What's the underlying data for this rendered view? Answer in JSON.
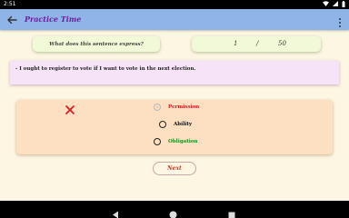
{
  "status_bar": {
    "time": "2:51"
  },
  "app_bar": {
    "title": "Practice Time"
  },
  "question": {
    "prompt": "What does this sentence express?"
  },
  "counter": {
    "current": "1",
    "separator": "/",
    "total": "50"
  },
  "sentence": {
    "text": "- I ought to register to vote if I want to vote in the next election."
  },
  "options": [
    {
      "label": "Permission",
      "color": "#e01b24",
      "state": "selected-wrong"
    },
    {
      "label": "Ability",
      "color": "#111111",
      "state": "unselected"
    },
    {
      "label": "Obligation",
      "color": "#1f8a1f",
      "state": "unselected"
    }
  ],
  "next_button": {
    "label": "Next"
  },
  "colors": {
    "app_bar": "#8fb5e8",
    "title": "#6b1f99",
    "wrong_mark": "#e01b24"
  }
}
